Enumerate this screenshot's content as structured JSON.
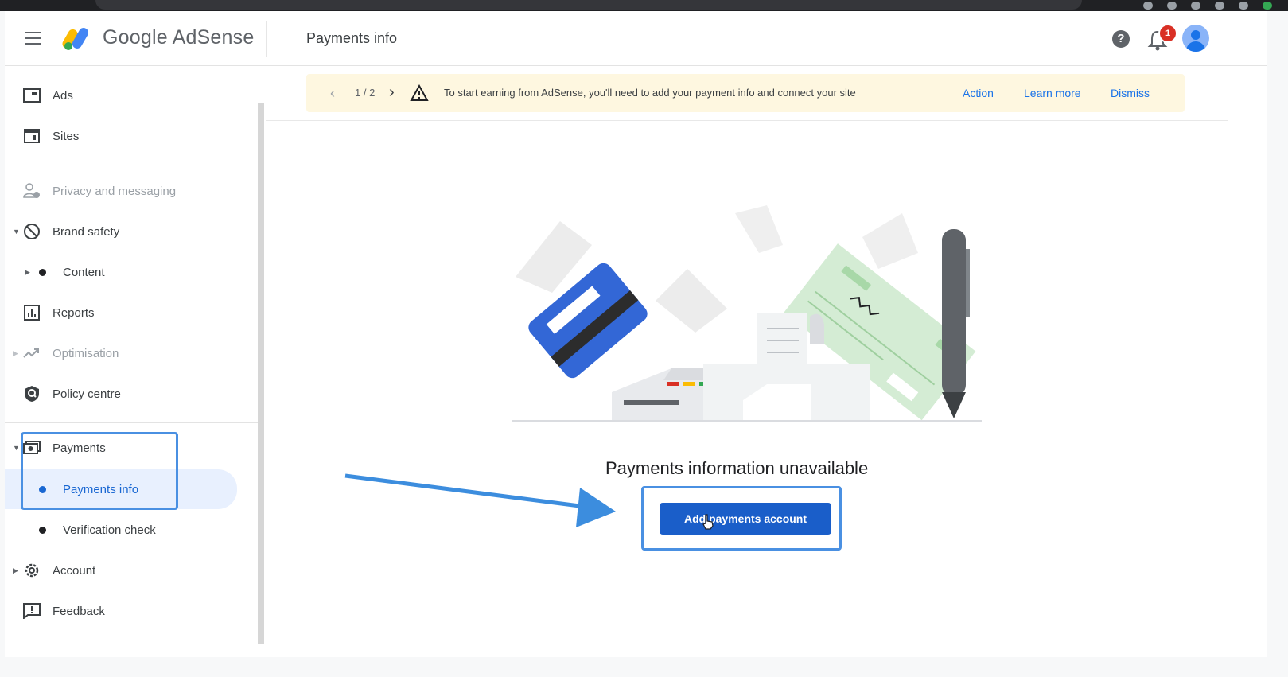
{
  "app": {
    "name": "Google AdSense",
    "page_title": "Payments info"
  },
  "header": {
    "notification_count": "1",
    "help_glyph": "?"
  },
  "sidebar": {
    "items": [
      {
        "label": "Ads",
        "icon": "ads-icon"
      },
      {
        "label": "Sites",
        "icon": "sites-icon"
      },
      {
        "label": "Privacy and messaging",
        "icon": "privacy-icon",
        "disabled": true
      },
      {
        "label": "Brand safety",
        "icon": "block-icon"
      },
      {
        "label": "Content",
        "icon": "dot"
      },
      {
        "label": "Reports",
        "icon": "reports-icon"
      },
      {
        "label": "Optimisation",
        "icon": "trending-icon",
        "disabled": true
      },
      {
        "label": "Policy centre",
        "icon": "shield-icon"
      },
      {
        "label": "Payments",
        "icon": "payments-icon"
      },
      {
        "label": "Payments info",
        "icon": "dot",
        "active": true
      },
      {
        "label": "Verification check",
        "icon": "dot"
      },
      {
        "label": "Account",
        "icon": "gear-icon"
      },
      {
        "label": "Feedback",
        "icon": "feedback-icon"
      }
    ]
  },
  "banner": {
    "pager": "1 / 2",
    "message": "To start earning from AdSense, you'll need to add your payment info and connect your site",
    "actions": [
      "Action",
      "Learn more",
      "Dismiss"
    ]
  },
  "main": {
    "empty_title": "Payments information unavailable",
    "add_button": "Add payments account"
  },
  "colors": {
    "accent": "#1a73e8",
    "button": "#1a5ec9",
    "banner_bg": "#fef7e0",
    "highlight": "#4a90e2"
  }
}
